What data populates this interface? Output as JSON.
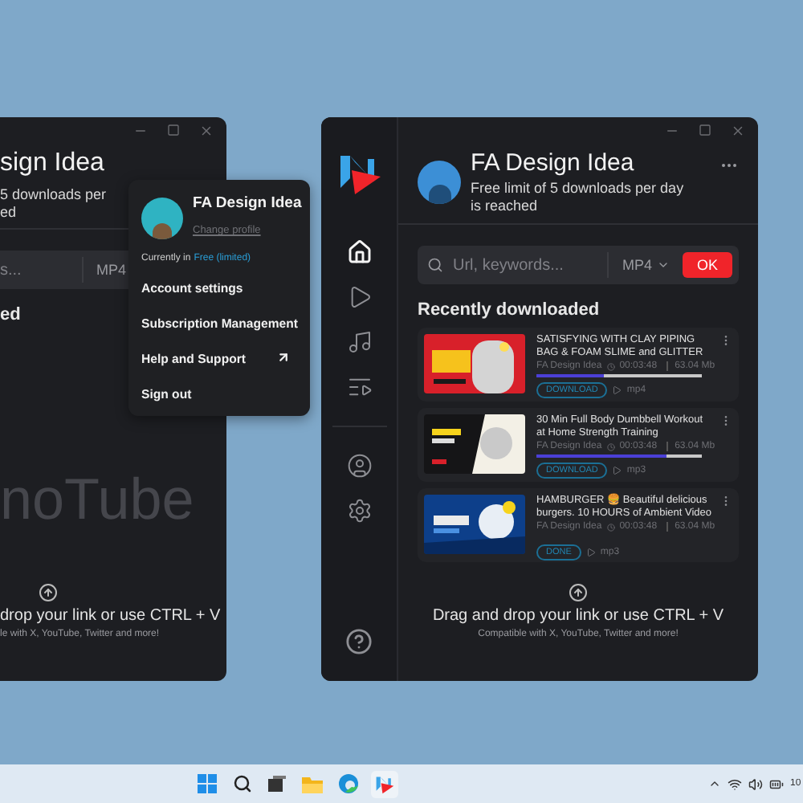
{
  "back_window": {
    "title": "sign Idea",
    "subtitle_lines": [
      "5 downloads per",
      "ed"
    ],
    "search_placeholder": "s...",
    "format": "MP4",
    "section_title": "ed",
    "brand": "noTube",
    "drop_text": "drop your link or use CTRL + V",
    "drop_hint": "le with X, YouTube, Twitter and more!"
  },
  "profile_menu": {
    "name": "FA Design Idea",
    "change_link": "Change profile",
    "plan_prefix": "Currently in",
    "plan": "Free (limited)",
    "items": [
      {
        "label": "Account settings",
        "external": false
      },
      {
        "label": "Subscription Management",
        "external": false
      },
      {
        "label": "Help and Support",
        "external": true
      },
      {
        "label": "Sign out",
        "external": false
      }
    ]
  },
  "app_window": {
    "nav": [
      {
        "kind": "home",
        "selected": true
      },
      {
        "kind": "play",
        "selected": false
      },
      {
        "kind": "music",
        "selected": false
      },
      {
        "kind": "playlist",
        "selected": false
      }
    ],
    "nav_bottom": [
      {
        "kind": "account",
        "selected": false
      },
      {
        "kind": "settings",
        "selected": false
      }
    ],
    "user": {
      "name": "FA Design Idea",
      "subtitle": "Free limit of 5 downloads per day is reached"
    },
    "search": {
      "placeholder": "Url, keywords...",
      "format": "MP4",
      "button": "OK"
    },
    "section_title": "Recently downloaded",
    "downloads": [
      {
        "title": "SATISFYING WITH CLAY PIPING BAG & FOAM SLIME and GLITTER",
        "channel": "FA Design Idea",
        "duration": "00:03:48",
        "size": "63.04 Mb",
        "kind": "downloading",
        "level": 0.41,
        "status": "DOWNLOAD",
        "format": "mp4"
      },
      {
        "title": "30 Min Full Body Dumbbell Workout at Home Strength Training",
        "channel": "FA Design Idea",
        "duration": "00:03:48",
        "size": "63.04 Mb",
        "kind": "downloading",
        "level": 0.79,
        "status": "DOWNLOAD",
        "format": "mp3"
      },
      {
        "title": "HAMBURGER 🍔 Beautiful delicious burgers. 10 HOURS of Ambient Video",
        "channel": "FA Design Idea",
        "duration": "00:03:48",
        "size": "63.04 Mb",
        "kind": "done",
        "status": "DONE",
        "format": "mp3"
      }
    ],
    "drop_text": "Drag and drop your link or use CTRL + V",
    "drop_hint": "Compatible with X, YouTube, Twitter and more!"
  },
  "taskbar": {
    "clock": "10"
  }
}
